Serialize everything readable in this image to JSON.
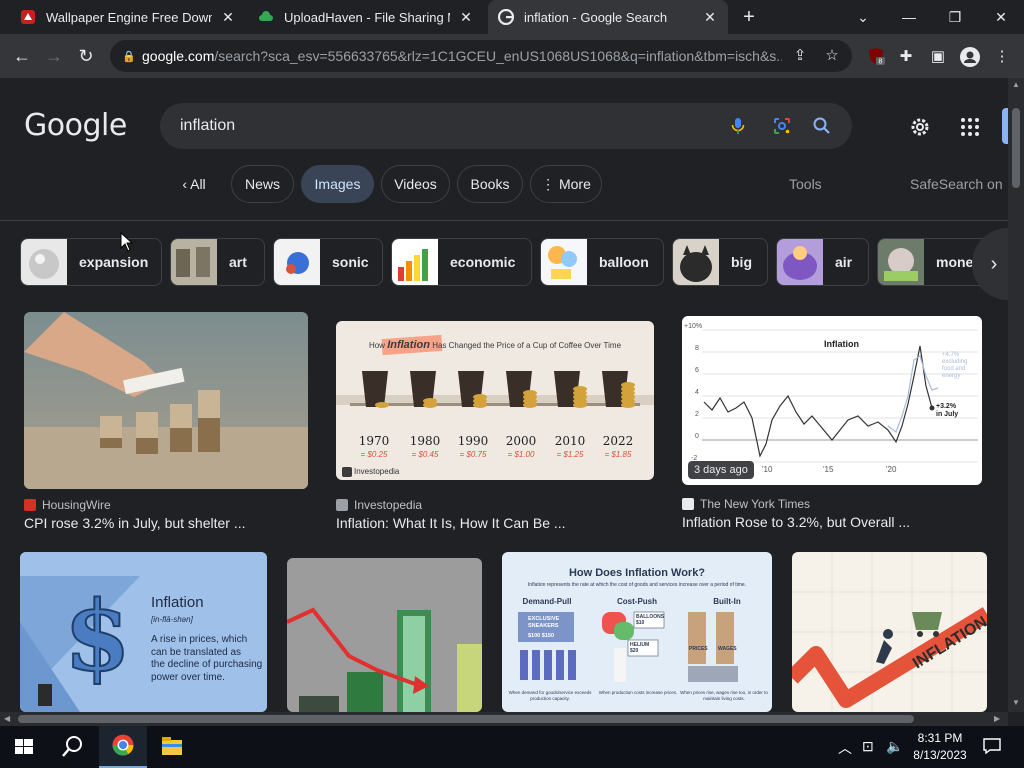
{
  "browser": {
    "tabs": [
      {
        "title": "Wallpaper Engine Free Downloa",
        "icon": "wallpaper-engine-icon",
        "active": false
      },
      {
        "title": "UploadHaven - File Sharing Mad",
        "icon": "uploadhaven-cloud-icon",
        "active": false
      },
      {
        "title": "inflation - Google Search",
        "icon": "google-g-icon",
        "active": true
      }
    ],
    "new_tab": "+",
    "url_host": "google.com",
    "url_rest": "/search?sca_esv=556633765&rlz=1C1GCEU_enUS1068US1068&q=inflation&tbm=isch&s...",
    "ublock_count": "8"
  },
  "google": {
    "logo": "Google",
    "query": "inflation",
    "tabs": [
      {
        "label": "All",
        "has_back": true
      },
      {
        "label": "News"
      },
      {
        "label": "Images",
        "selected": true
      },
      {
        "label": "Videos"
      },
      {
        "label": "Books"
      },
      {
        "label": "More",
        "has_dots": true
      }
    ],
    "tools": "Tools",
    "safesearch": "SafeSearch on"
  },
  "related": [
    {
      "label": "expansion"
    },
    {
      "label": "art"
    },
    {
      "label": "sonic"
    },
    {
      "label": "economic"
    },
    {
      "label": "balloon"
    },
    {
      "label": "big"
    },
    {
      "label": "air"
    },
    {
      "label": "mone"
    }
  ],
  "results": [
    {
      "source": "HousingWire",
      "caption": "CPI rose 3.2% in July, but shelter ...",
      "source_color": "#d93025"
    },
    {
      "source": "Investopedia",
      "caption": "Inflation: What It Is, How It Can Be ...",
      "source_color": "#9aa0a6",
      "image_title_a": "How ",
      "image_title_b": "Inflation",
      "image_title_c": " Has Changed the Price of a Cup of Coffee Over Time",
      "years": [
        "1970",
        "1980",
        "1990",
        "2000",
        "2010",
        "2022"
      ],
      "prices": [
        "= $0.25",
        "= $0.45",
        "= $0.75",
        "= $1.00",
        "= $1.25",
        "= $1.85"
      ],
      "credit": "Investopedia"
    },
    {
      "source": "The New York Times",
      "caption": "Inflation Rose to 3.2%, but Overall ...",
      "source_color": "#e8eaed",
      "badge": "3 days ago",
      "chart_title": "Inflation",
      "y_ticks": [
        "+10%",
        "8",
        "6",
        "4",
        "2",
        "0",
        "-2"
      ],
      "x_ticks": [
        "'10",
        "'15",
        "'20"
      ],
      "note_top_lines": [
        "+4.7%",
        "excluding",
        "food and",
        "energy"
      ],
      "note_bottom_lines": [
        "+3.2%",
        "in July"
      ]
    },
    {
      "title": "Inflation",
      "pron": "[in-flā-shən]",
      "definition_lines": [
        "A rise in prices, which",
        "can be translated as",
        "the decline of purchasing",
        "power over time."
      ]
    },
    {},
    {
      "title": "How Does Inflation Work?",
      "subtitle": "Inflation represents the rate at which the cost of goods and services increase over a period of time.",
      "columns": [
        "Demand-Pull",
        "Cost-Push",
        "Built-In"
      ],
      "exclusive": "EXCLUSIVE",
      "sneakers": "SNEAKERS",
      "price1": "$100",
      "price2": "$150",
      "balloons": "BALLOONS",
      "balloon_price": "$10",
      "helium": "HELIUM",
      "helium_price": "$20",
      "prices_label": "PRICES",
      "wages_label": "WAGES",
      "bottom_lines": [
        "When demand for goods/service exceeds production capacity.",
        "When production costs increase prices.",
        "When prices rise, wages rise too, in order to maintain living costs."
      ]
    },
    {
      "word": "INFLATION"
    }
  ],
  "taskbar": {
    "time": "8:31 PM",
    "date": "8/13/2023"
  },
  "colors": {
    "bg": "#202124",
    "chip_selected": "#394457",
    "text": "#e8eaed",
    "muted": "#9aa0a6"
  }
}
